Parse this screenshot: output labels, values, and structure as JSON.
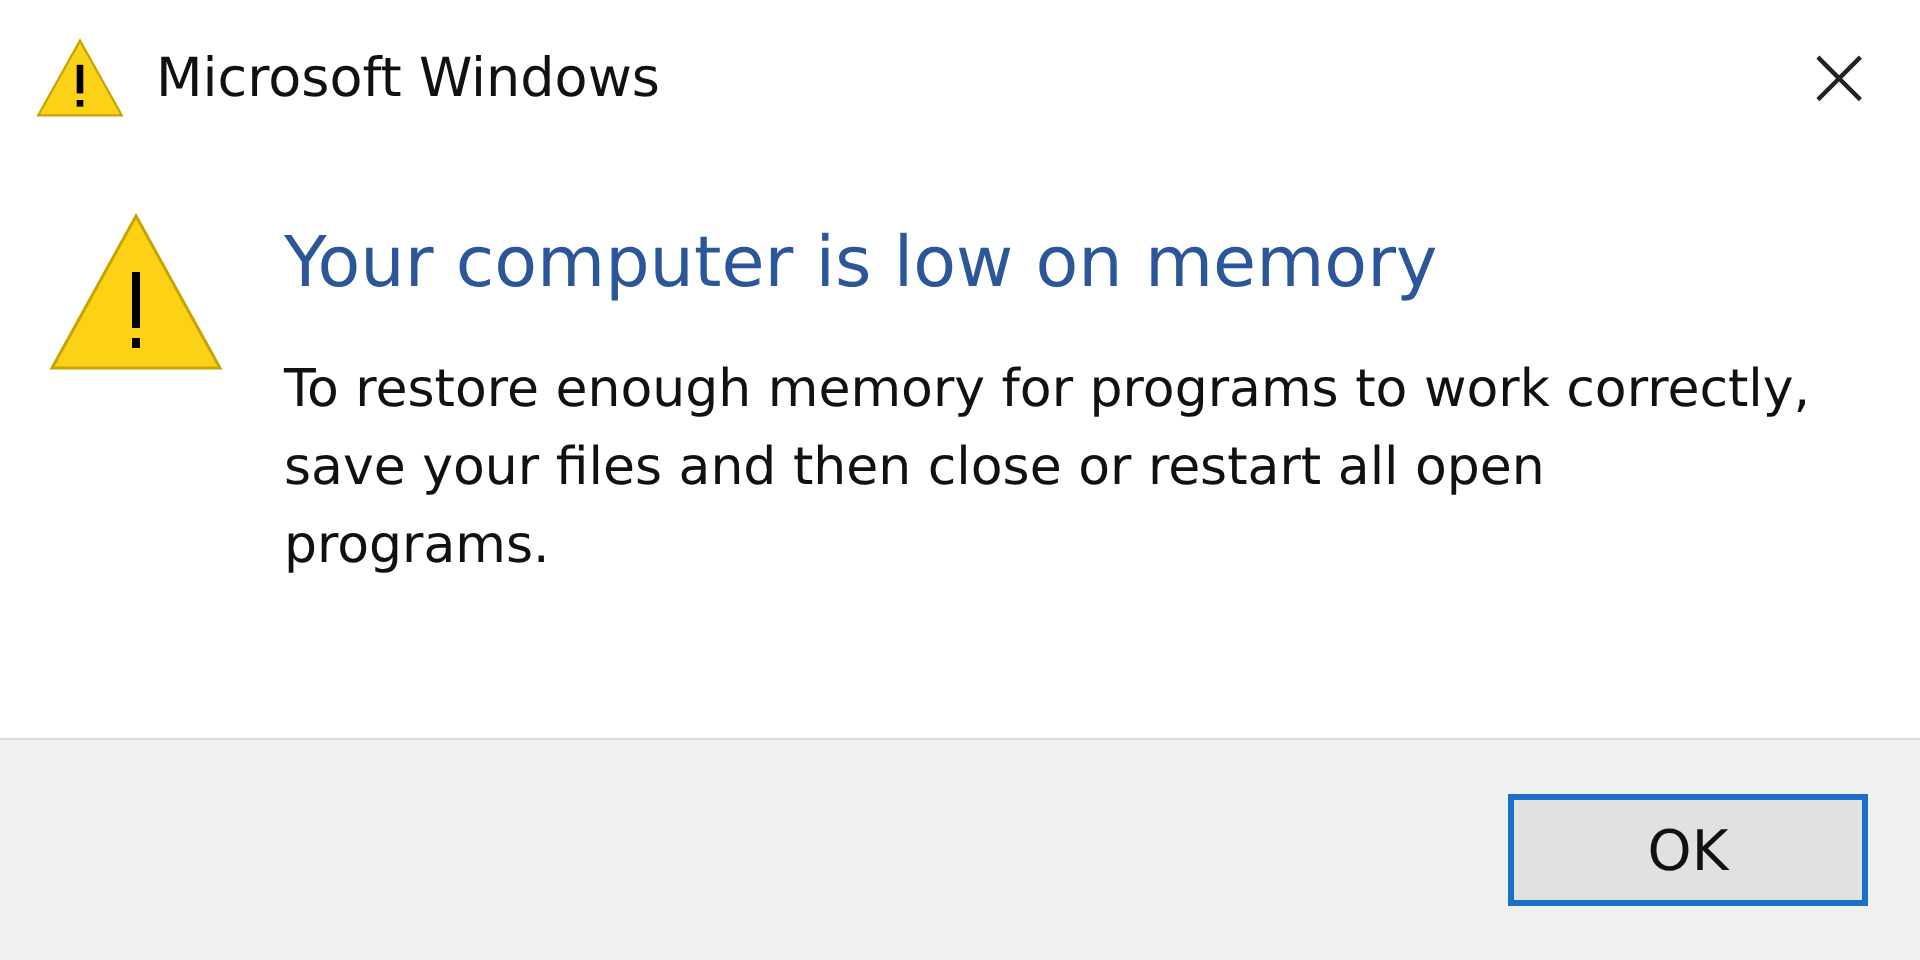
{
  "window": {
    "title": "Microsoft Windows",
    "close": "×"
  },
  "message": {
    "heading": "Your computer is low on memory",
    "body": "To restore enough memory for programs to work correctly, save your files and then close or restart all open programs."
  },
  "buttons": [
    {
      "label": "OK",
      "selected": true
    }
  ]
}
